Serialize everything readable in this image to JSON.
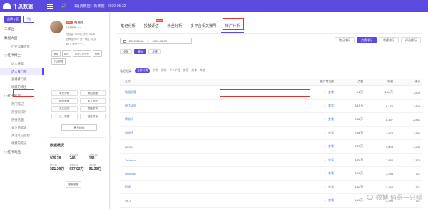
{
  "topbar": {
    "brand": "千瓜数据",
    "notice": "【消费数据】新数据 · 2020-05-22",
    "speaker_icon": "speaker-icon",
    "menu_icon": "menu-icon"
  },
  "sidebar": {
    "tabs": [
      "品牌专区",
      "行业"
    ],
    "items": [
      {
        "type": "item",
        "label": "工作台"
      },
      {
        "type": "group",
        "label": "数据大盘"
      },
      {
        "type": "sub",
        "label": "行业流量大盘"
      },
      {
        "type": "group",
        "label": "小红书博主"
      },
      {
        "type": "sub",
        "label": "达人搜索"
      },
      {
        "type": "sub",
        "label": "达人排行榜",
        "active": true
      },
      {
        "type": "sub",
        "label": "直播排行榜"
      },
      {
        "type": "sub",
        "label": "收藏的博主"
      },
      {
        "type": "group",
        "label": "小红书笔记"
      },
      {
        "type": "sub",
        "label": "热门笔记"
      },
      {
        "type": "sub",
        "label": "热搜词排行"
      },
      {
        "type": "sub",
        "label": "热搜话题"
      },
      {
        "type": "sub",
        "label": "关注的笔记"
      },
      {
        "type": "sub",
        "label": "关注笔记监控"
      },
      {
        "type": "sub",
        "label": "收藏的笔记"
      },
      {
        "type": "group",
        "label": "小红书商品"
      }
    ]
  },
  "profile": {
    "name": "赵露思",
    "badge": "LV6",
    "lines": [
      "小红书号: xxx",
      "粉丝量: 1234 | 获赞: 5678",
      "品牌合作人: 是 · 地区: 北京",
      "简介: 我是一个..."
    ],
    "tags": [
      "美妆",
      "穿搭",
      "日常生活分享",
      "颜值",
      "个人护理"
    ],
    "actions": [
      "笔记分析",
      "添加收藏",
      "粉丝画像",
      "加入对比",
      "关注监控",
      "直播带货",
      "达人周报",
      "批量导出"
    ],
    "full_button": "更多操作",
    "overview_title": "数据概况",
    "stats": [
      {
        "label": "平均点赞",
        "value": "926.28"
      },
      {
        "label": "平均收藏",
        "value": "246"
      },
      {
        "label": "平均评论",
        "value": "181"
      },
      {
        "label": "粉丝数",
        "value": "321.36万"
      },
      {
        "label": "赞藏总数",
        "value": "697.02万"
      },
      {
        "label": "互动率",
        "value": "91.36万"
      }
    ],
    "refresh": "更新数据"
  },
  "main": {
    "tabs": [
      {
        "label": "笔记分析"
      },
      {
        "label": "投放评估",
        "badge": "NEW"
      },
      {
        "label": "粉丝分析"
      },
      {
        "label": "多平台相关账号"
      },
      {
        "label": "推广分析",
        "active": true
      }
    ],
    "date_start": "2020-05-16",
    "date_sep": "→",
    "date_end": "2020-05-09",
    "views": [
      "笔记排行",
      "点赞排行",
      "收藏排行",
      "评论排行"
    ],
    "active_view": 1,
    "sort": [
      "全部",
      "美妆",
      "品牌"
    ],
    "active_sort": 1,
    "filter_label": "笔记分类:",
    "filters": [
      "全部分类",
      "护肤",
      "彩妆",
      "个人护理",
      "穿搭",
      "美食",
      "其他"
    ],
    "active_filter": 0,
    "headers": {
      "brand": "品牌",
      "notes": "推广笔记数",
      "likes": "点赞",
      "collects": "收藏",
      "comments": "评论"
    },
    "rows": [
      {
        "brand": "瑞福润雅",
        "notes": "1",
        "link": "查看",
        "likes": "4.2万",
        "collects": "1.41万",
        "comments": "1,805"
      },
      {
        "brand": "纽比诺思",
        "notes": "1",
        "link": "查看",
        "likes": "3.19万",
        "collects": "6,179",
        "comments": "1,849"
      },
      {
        "brand": "娇韵诗",
        "notes": "1",
        "link": "查看",
        "likes": "2.88万",
        "collects": "8,357",
        "comments": "2,881"
      },
      {
        "brand": "科颜氏",
        "notes": "1",
        "link": "查看",
        "likes": "2.46万",
        "collects": "4,978",
        "comments": "1,853"
      },
      {
        "brand": "ACGO",
        "notes": "1",
        "link": "查看",
        "likes": "2.27万",
        "collects": "4,009",
        "comments": "1,206"
      },
      {
        "brand": "Topbeso",
        "notes": "1",
        "link": "查看",
        "likes": "1.97万",
        "collects": "1,552",
        "comments": "1,179"
      },
      {
        "brand": "UNIONE",
        "notes": "1",
        "link": "查看",
        "likes": "1.47万",
        "collects": "3,294",
        "comments": "721"
      },
      {
        "brand": "珂润",
        "notes": "1",
        "link": "查看",
        "likes": "1.47万",
        "collects": "3,294",
        "comments": "721"
      },
      {
        "brand": "SK-II",
        "notes": "1",
        "link": "查看",
        "likes": "1.47万",
        "collects": "3,296",
        "comments": "721"
      }
    ]
  },
  "watermark": "微博 值得一只喵",
  "colors": {
    "accent": "#5b4ae0",
    "highlight": "#e03333",
    "link": "#4a78d0"
  }
}
